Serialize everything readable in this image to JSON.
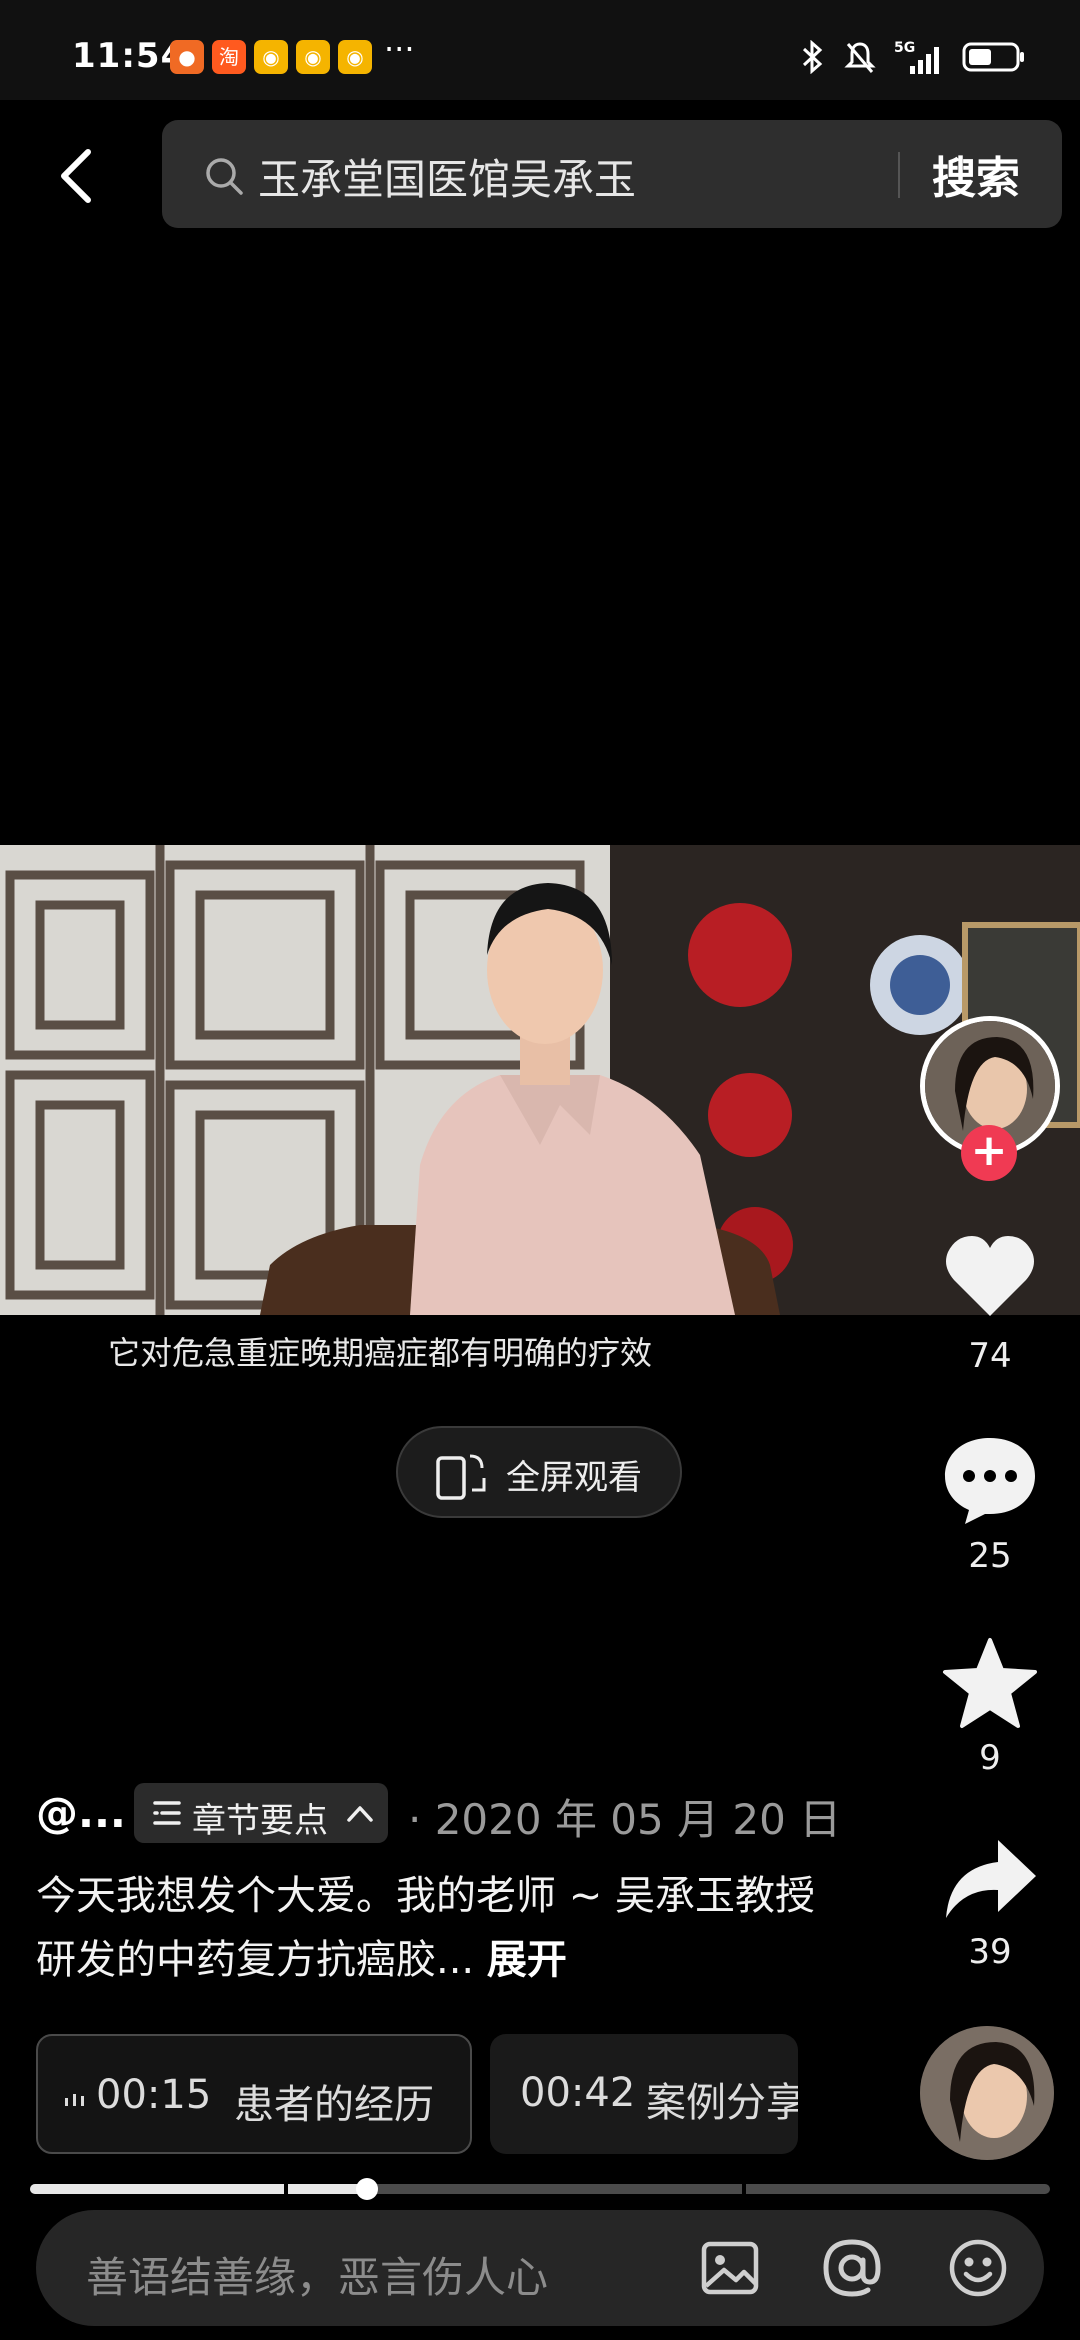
{
  "status_bar": {
    "time": "11:54",
    "more": "···",
    "network": "5G"
  },
  "search": {
    "query": "玉承堂国医馆吴承玉",
    "button": "搜索"
  },
  "video": {
    "subtitle": "它对危急重症晚期癌症都有明确的疗效",
    "fullscreen_label": "全屏观看"
  },
  "rail": {
    "likes": "74",
    "comments": "25",
    "favorites": "9",
    "shares": "39"
  },
  "meta": {
    "author": "@...",
    "chapter_chip": "章节要点",
    "date": "· 2020 年 05 月 20 日",
    "description": "今天我想发个大爱。我的老师 ~ 吴承玉教授研发的中药复方抗癌胶... ",
    "expand": "展开"
  },
  "chapters": [
    {
      "time": "00:15",
      "title": "患者的经历"
    },
    {
      "time": "00:42",
      "title": "案例分享"
    }
  ],
  "progress": {
    "played_fraction": 0.33
  },
  "comment": {
    "placeholder": "善语结善缘，恶言伤人心"
  }
}
